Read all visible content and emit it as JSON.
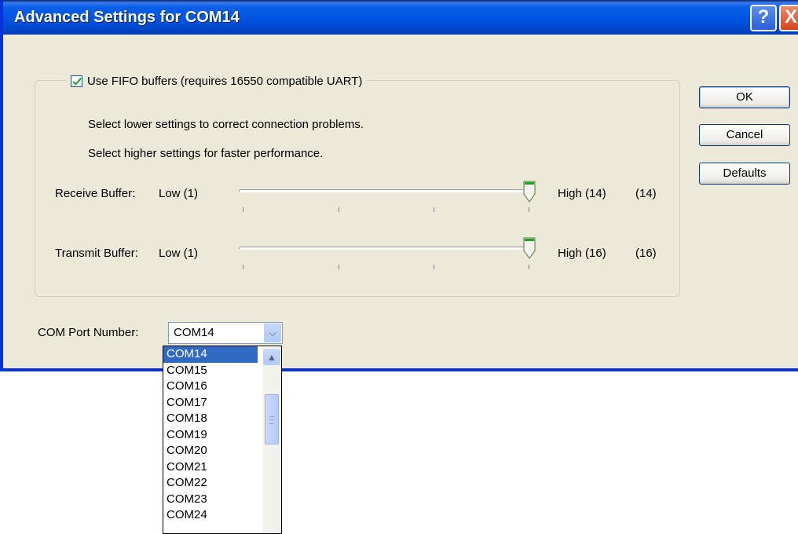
{
  "window": {
    "title": "Advanced Settings for COM14"
  },
  "title_buttons": {
    "help": "?",
    "close": "X"
  },
  "fifo": {
    "checkbox_label": "Use FIFO buffers (requires 16550 compatible UART)",
    "checked": true,
    "hint_lower": "Select lower settings to correct connection problems.",
    "hint_higher": "Select higher settings for faster performance."
  },
  "receive_buffer": {
    "label": "Receive Buffer:",
    "low_label": "Low (1)",
    "high_label": "High (14)",
    "value_text": "(14)",
    "level_fraction": 1.0
  },
  "transmit_buffer": {
    "label": "Transmit Buffer:",
    "low_label": "Low (1)",
    "high_label": "High (16)",
    "value_text": "(16)",
    "level_fraction": 1.0
  },
  "buttons": {
    "ok": "OK",
    "cancel": "Cancel",
    "defaults": "Defaults"
  },
  "com_port": {
    "label": "COM Port Number:",
    "selected": "COM14",
    "options": [
      "COM14",
      "COM15",
      "COM16",
      "COM17",
      "COM18",
      "COM19",
      "COM20",
      "COM21",
      "COM22",
      "COM23",
      "COM24"
    ]
  },
  "icons": {
    "combo_arrow": "chevron-down-icon",
    "scroll_up": "chevron-up-icon"
  },
  "colors": {
    "title_bar": "#0054e3",
    "dialog_bg": "#ece9d8",
    "selection": "#316ac5",
    "thumb_green": "#21a121"
  }
}
